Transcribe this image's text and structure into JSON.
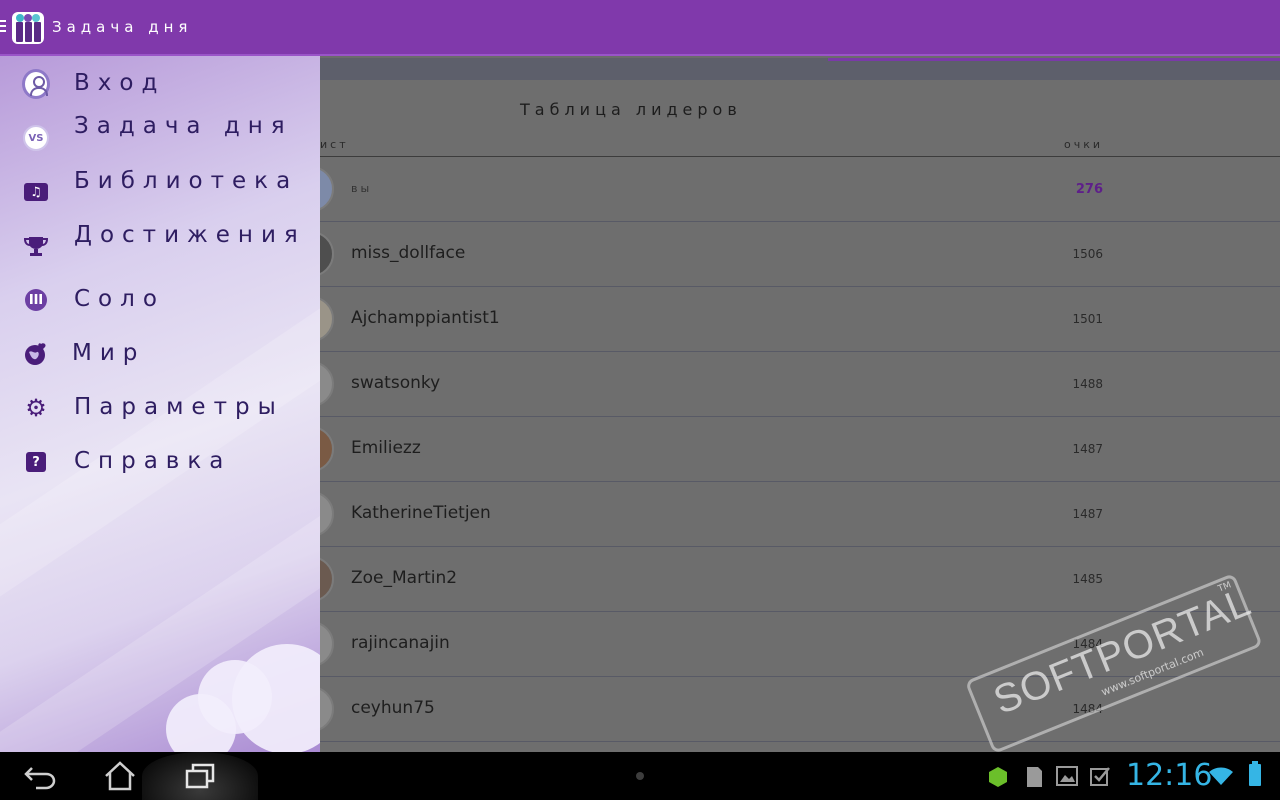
{
  "app_bar": {
    "title": "Задача дня"
  },
  "drawer": {
    "items": [
      {
        "label": "Вход",
        "icon": "user-login-icon"
      },
      {
        "label": "Задача дня",
        "icon": "vs-icon",
        "icon_text": "VS"
      },
      {
        "label": "Библиотека",
        "icon": "music-library-icon",
        "icon_text": "♫"
      },
      {
        "label": "Достижения",
        "icon": "trophy-icon"
      },
      {
        "label": "Соло",
        "icon": "piano-keys-icon"
      },
      {
        "label": "Мир",
        "icon": "globe-heart-icon"
      },
      {
        "label": "Параметры",
        "icon": "gear-icon",
        "icon_text": "⚙"
      },
      {
        "label": "Справка",
        "icon": "help-icon",
        "icon_text": "?"
      }
    ]
  },
  "leaderboard": {
    "title": "Таблица лидеров",
    "col_player": "ист",
    "col_points": "очки",
    "rows": [
      {
        "name": "вы",
        "score": "276"
      },
      {
        "name": "miss_dollface",
        "score": "1506"
      },
      {
        "name": "Ajchamppiantist1",
        "score": "1501"
      },
      {
        "name": "swatsonky",
        "score": "1488"
      },
      {
        "name": "Emiliezz",
        "score": "1487"
      },
      {
        "name": "KatherineTietjen",
        "score": "1487"
      },
      {
        "name": "Zoe_Martin2",
        "score": "1485"
      },
      {
        "name": "rajincanajin",
        "score": "1484"
      },
      {
        "name": "ceyhun75",
        "score": "1484"
      }
    ]
  },
  "status_bar": {
    "clock": "12:16"
  },
  "watermark": {
    "main": "SOFTPORTAL",
    "sub": "www.softportal.com",
    "tm": "TM"
  },
  "colors": {
    "app_bar": "#8039ab",
    "accent_text": "#2e1d61",
    "clock": "#35b5e5",
    "my_score": "#5e1f8a"
  }
}
